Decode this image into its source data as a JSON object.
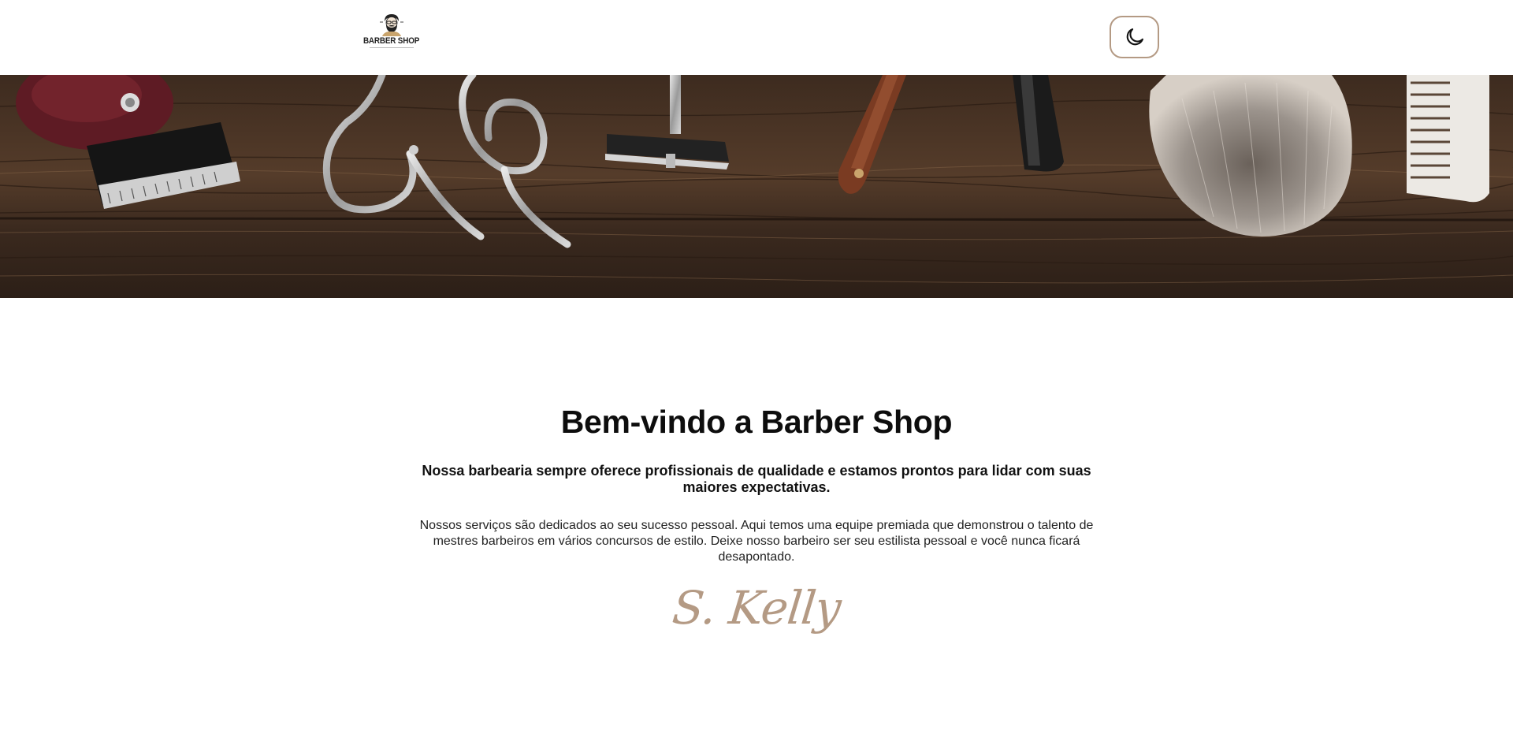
{
  "header": {
    "logo_text": "BARBER SHOP",
    "theme_toggle_icon": "moon-icon"
  },
  "banner": {
    "image": "barber-tools-on-wood-banner"
  },
  "main": {
    "title": "Bem-vindo a Barber Shop",
    "lead": "Nossa barbearia sempre oferece profissionais de qualidade e estamos prontos para lidar com suas maiores expectativas.",
    "body": "Nossos serviços são dedicados ao seu sucesso pessoal. Aqui temos uma equipe premiada que demonstrou o talento de mestres barbeiros em vários concursos de estilo. Deixe nosso barbeiro ser seu estilista pessoal e você nunca ficará desapontado.",
    "signature": "S. Kelly"
  },
  "colors": {
    "accent": "#b49a84",
    "text": "#111111",
    "background": "#ffffff"
  }
}
